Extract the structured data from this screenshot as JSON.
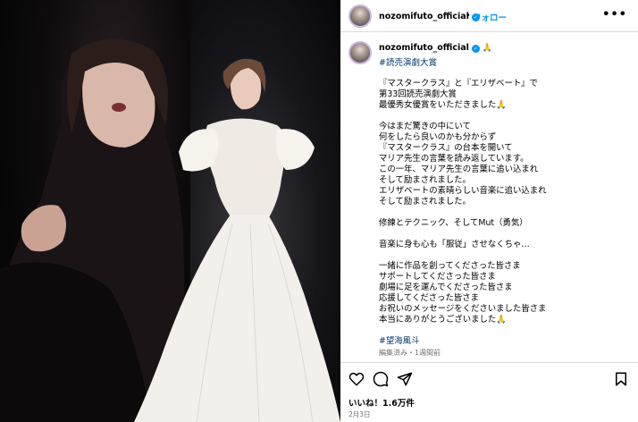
{
  "post": {
    "username": "nozomifuto_official",
    "verified_mark": "✓",
    "follow_label": "フォロー",
    "separator": "•",
    "more_label": "•••",
    "caption_emoji": "🙏",
    "top_hashtag": "#読売演劇大賞",
    "caption_lines": [
      "『マスタークラス』と『エリザベート』で",
      "第33回読売演劇大賞",
      "最優秀女優賞をいただきました🙏",
      "",
      "今はまだ驚きの中にいて",
      "何をしたら良いのかも分からず",
      "『マスタークラス』の台本を開いて",
      "マリア先生の言葉を読み返しています。",
      "この一年、マリア先生の言葉に追い込まれ",
      "そして励まされました。",
      "エリザベートの素晴らしい音楽に追い込まれ",
      "そして励まされました。",
      "",
      "修練とテクニック、そしてMut（勇気）",
      "",
      "音楽に身も心も「服従」させなくちゃ…",
      "",
      "一緒に作品を創ってくださった皆さま",
      "サポートしてくださった皆さま",
      "劇場に足を運んでくださった皆さま",
      "応援してくださった皆さま",
      "お祝いのメッセージをくださいました皆さま",
      "本当にありがとうございました🙏",
      ""
    ],
    "bottom_hashtag": "#望海風斗",
    "edited_label": "編集済み・1週間前",
    "likes_label": "いいね！1.6万件",
    "date_label": "2月3日"
  },
  "icons": {
    "avatar": "avatar",
    "verified": "verified-badge-icon",
    "like": "heart-icon",
    "comment": "comment-icon",
    "share": "send-icon",
    "save": "bookmark-icon",
    "more": "more-options-icon"
  },
  "colors": {
    "link": "#0095f6",
    "hashtag": "#00376b",
    "muted": "#737373",
    "border": "#dbdbdb"
  }
}
